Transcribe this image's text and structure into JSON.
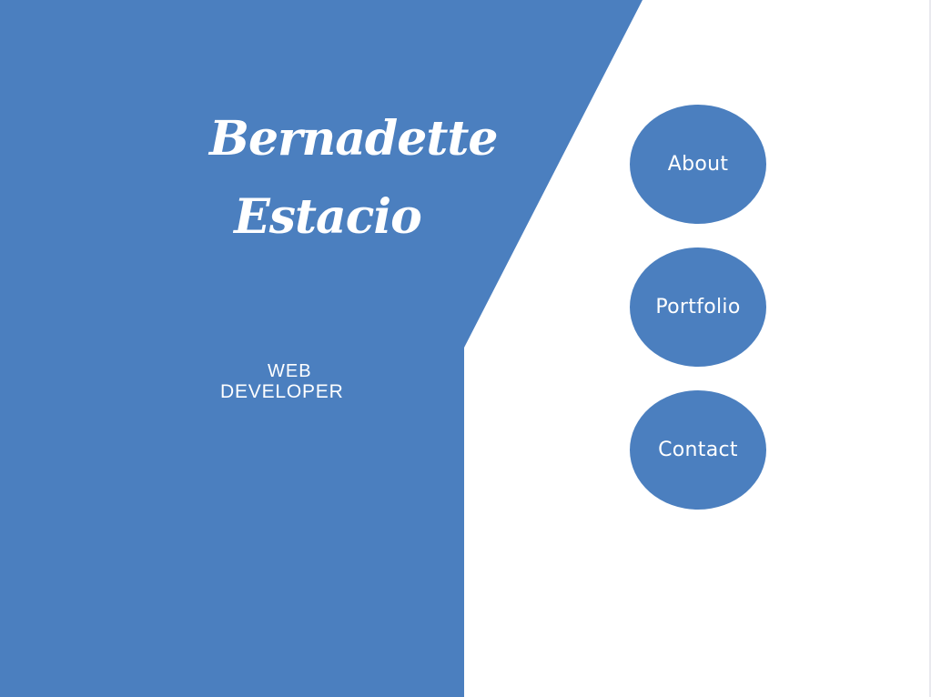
{
  "brand": {
    "first_name": "Bernadette",
    "last_name": "Estacio",
    "role_line_1": "WEB",
    "role_line_2": "DEVELOPER"
  },
  "nav": {
    "items": [
      {
        "label": "About"
      },
      {
        "label": "Portfolio"
      },
      {
        "label": "Contact"
      }
    ]
  },
  "colors": {
    "primary_blue": "#4b7fbf",
    "background": "#ffffff",
    "text_on_blue": "#ffffff"
  }
}
